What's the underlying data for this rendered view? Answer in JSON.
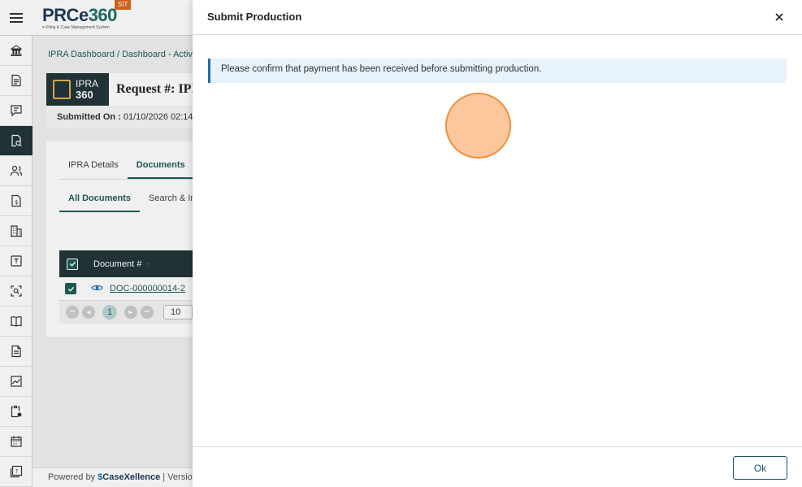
{
  "app": {
    "logo_text_main": "PRCe",
    "logo_text_accent": "360",
    "logo_tagline": "e-Filing & Case Management System",
    "env_badge": "SIT"
  },
  "sidebar": {
    "items": [
      {
        "icon": "bank-icon"
      },
      {
        "icon": "document-icon"
      },
      {
        "icon": "chat-icon"
      },
      {
        "icon": "document-search-icon",
        "active": true
      },
      {
        "icon": "users-icon"
      },
      {
        "icon": "invoice-icon"
      },
      {
        "icon": "building-icon"
      },
      {
        "icon": "template-icon"
      },
      {
        "icon": "scan-icon"
      },
      {
        "icon": "book-icon"
      },
      {
        "icon": "file-icon"
      },
      {
        "icon": "chart-icon"
      },
      {
        "icon": "clipboard-icon"
      },
      {
        "icon": "calendar-icon"
      },
      {
        "icon": "help-icon"
      }
    ]
  },
  "page": {
    "breadcrumb": "IPRA Dashboard / Dashboard - Activ",
    "badge_line1": "IPRA",
    "badge_line2": "360",
    "request_title": "Request #: IPI",
    "submitted_label": "Submitted On :",
    "submitted_value": "01/10/2026 02:14",
    "tabs": [
      "IPRA Details",
      "Documents"
    ],
    "subtabs": [
      "All Documents",
      "Search & In"
    ],
    "grid_header": "Document #",
    "grid_row_doc": "DOC-000000014-2",
    "pager_page": "1",
    "pager_size": "10"
  },
  "footer": {
    "powered_by": "Powered by",
    "brand": "CaseXellence",
    "separator": "|",
    "version_label": "Versio"
  },
  "modal": {
    "title": "Submit Production",
    "close_symbol": "×",
    "message": "Please confirm that payment has been received before submitting production.",
    "ok_label": "Ok"
  },
  "colors": {
    "primary_dark": "#23363a",
    "accent_teal": "#1f5d5a",
    "alert_bg": "#e8f2fa",
    "alert_border": "#1f6eaa",
    "badge_orange": "#d9691e",
    "click_indicator": "#fdc79e"
  }
}
